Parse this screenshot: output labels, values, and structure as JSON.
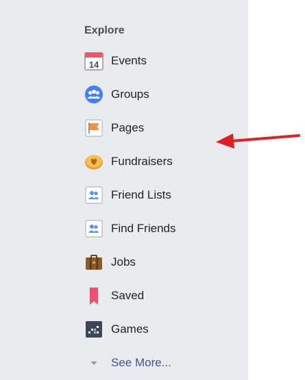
{
  "explore": {
    "title": "Explore",
    "items": [
      {
        "label": "Events",
        "icon": "calendar-icon"
      },
      {
        "label": "Groups",
        "icon": "groups-icon"
      },
      {
        "label": "Pages",
        "icon": "flag-icon"
      },
      {
        "label": "Fundraisers",
        "icon": "fundraiser-heart-icon"
      },
      {
        "label": "Friend Lists",
        "icon": "friend-list-icon"
      },
      {
        "label": "Find Friends",
        "icon": "find-friends-icon"
      },
      {
        "label": "Jobs",
        "icon": "briefcase-icon"
      },
      {
        "label": "Saved",
        "icon": "bookmark-icon"
      },
      {
        "label": "Games",
        "icon": "games-icon"
      }
    ],
    "see_more": "See More...",
    "calendar_day": "14"
  },
  "colors": {
    "panel_bg": "#e9ebee",
    "link": "#365899",
    "arrow": "#e02020"
  }
}
